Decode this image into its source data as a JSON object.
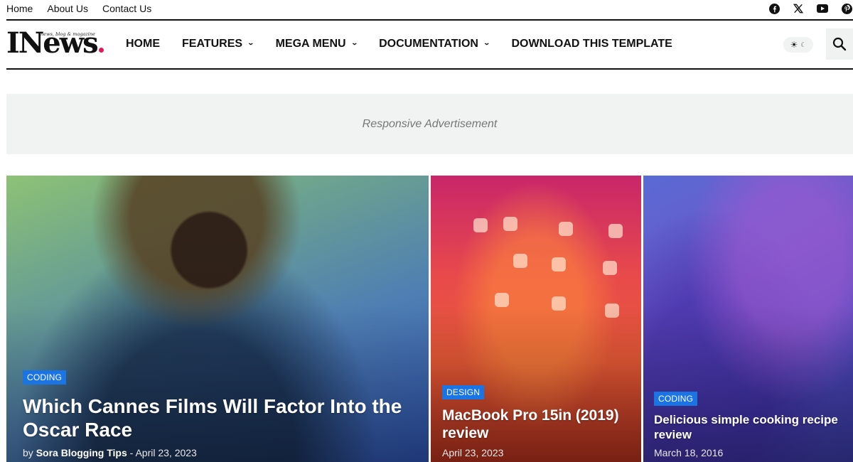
{
  "top_nav": {
    "links": [
      "Home",
      "About Us",
      "Contact Us"
    ]
  },
  "socials": [
    "facebook-icon",
    "x-icon",
    "youtube-icon",
    "pinterest-icon"
  ],
  "logo": {
    "text": "INews",
    "tagline": "news, blog & magazine",
    "dot_color": "#e2185b"
  },
  "main_nav": {
    "items": [
      {
        "label": "HOME",
        "dropdown": false
      },
      {
        "label": "FEATURES",
        "dropdown": true
      },
      {
        "label": "MEGA MENU",
        "dropdown": true
      },
      {
        "label": "DOCUMENTATION",
        "dropdown": true
      },
      {
        "label": "DOWNLOAD THIS TEMPLATE",
        "dropdown": false
      }
    ]
  },
  "ad": {
    "label": "Responsive Advertisement"
  },
  "featured": [
    {
      "category": "CODING",
      "title": "Which Cannes Films Will Factor Into the Oscar Race",
      "author_prefix": "by",
      "author": "Sora Blogging Tips",
      "separator": "-",
      "date": "April 23, 2023"
    },
    {
      "category": "DESIGN",
      "title": "MacBook Pro 15in (2019) review",
      "date": "April 23, 2023"
    },
    {
      "category": "CODING",
      "title": "Delicious simple cooking recipe review",
      "date": "March 18, 2016"
    }
  ],
  "colors": {
    "accent": "#1b74e4",
    "logo_dot": "#e2185b",
    "ad_bg": "#f1f2f2"
  }
}
